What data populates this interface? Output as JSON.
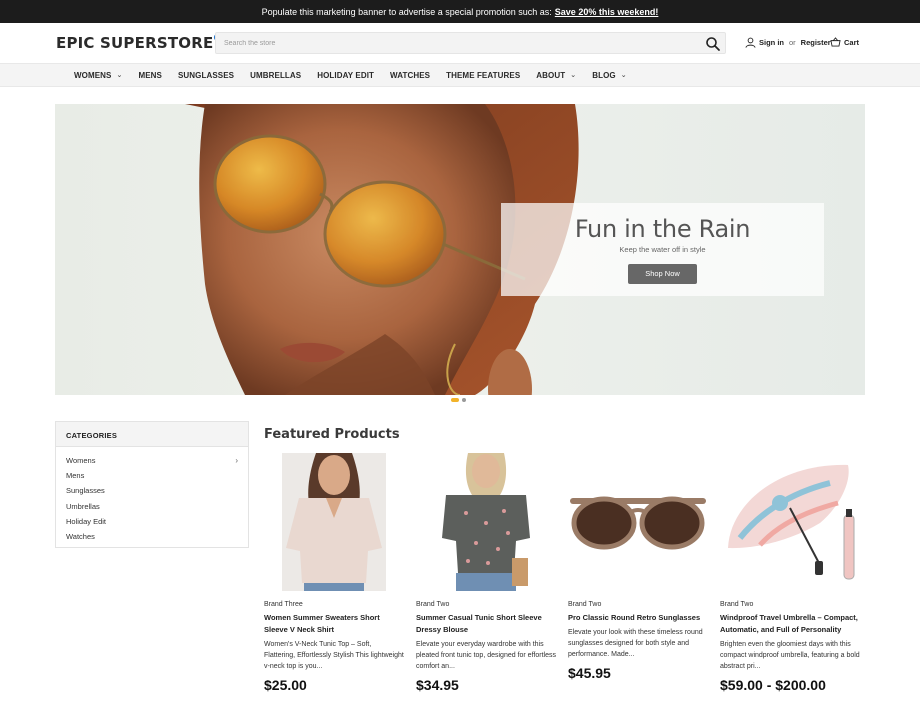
{
  "promo": {
    "text": "Populate this marketing banner to advertise a special promotion such as:",
    "link": "Save 20% this weekend!"
  },
  "header": {
    "logo": "EPIC SUPERSTORE",
    "search_placeholder": "Search the store",
    "sign_in": "Sign in",
    "or": "or",
    "register": "Register",
    "cart": "Cart"
  },
  "nav": {
    "items": [
      {
        "label": "WOMENS",
        "dropdown": true
      },
      {
        "label": "MENS",
        "dropdown": false
      },
      {
        "label": "SUNGLASSES",
        "dropdown": false
      },
      {
        "label": "UMBRELLAS",
        "dropdown": false
      },
      {
        "label": "HOLIDAY EDIT",
        "dropdown": false
      },
      {
        "label": "WATCHES",
        "dropdown": false
      },
      {
        "label": "THEME FEATURES",
        "dropdown": false
      },
      {
        "label": "ABOUT",
        "dropdown": true
      },
      {
        "label": "BLOG",
        "dropdown": true
      }
    ]
  },
  "hero": {
    "title": "Fun in the Rain",
    "subtitle": "Keep the water off in style",
    "button": "Shop Now"
  },
  "categories": {
    "heading": "CATEGORIES",
    "items": [
      "Womens",
      "Mens",
      "Sunglasses",
      "Umbrellas",
      "Holiday Edit",
      "Watches"
    ]
  },
  "featured": {
    "title": "Featured Products",
    "products": [
      {
        "brand": "Brand Three",
        "name": "Women Summer Sweaters Short Sleeve V Neck Shirt",
        "description": "Women's V-Neck Tunic Top – Soft, Flattering, Effortlessly Stylish This lightweight v-neck top is you...",
        "price": "$25.00"
      },
      {
        "brand": "Brand Two",
        "name": "Summer Casual Tunic Short Sleeve Dressy Blouse",
        "description": "Elevate your everyday wardrobe with this pleated front tunic top, designed for effortless comfort an...",
        "price": "$34.95"
      },
      {
        "brand": "Brand Two",
        "name": "Pro Classic Round Retro Sunglasses",
        "description": "Elevate your look with these timeless round sunglasses designed for both style and performance. Made...",
        "price": "$45.95"
      },
      {
        "brand": "Brand Two",
        "name": "Windproof Travel Umbrella – Compact, Automatic, and Full of Personality",
        "description": "Brighten even the gloomiest days with this compact windproof umbrella, featuring a bold abstract pri...",
        "price": "$59.00 - $200.00"
      }
    ]
  },
  "colors": {
    "promo_bg": "#1c1c1c",
    "nav_bg": "#f4f4f4",
    "logo_dot": "#2b7bd0",
    "button_bg": "#676767",
    "carousel_active": "#f2b32a"
  }
}
